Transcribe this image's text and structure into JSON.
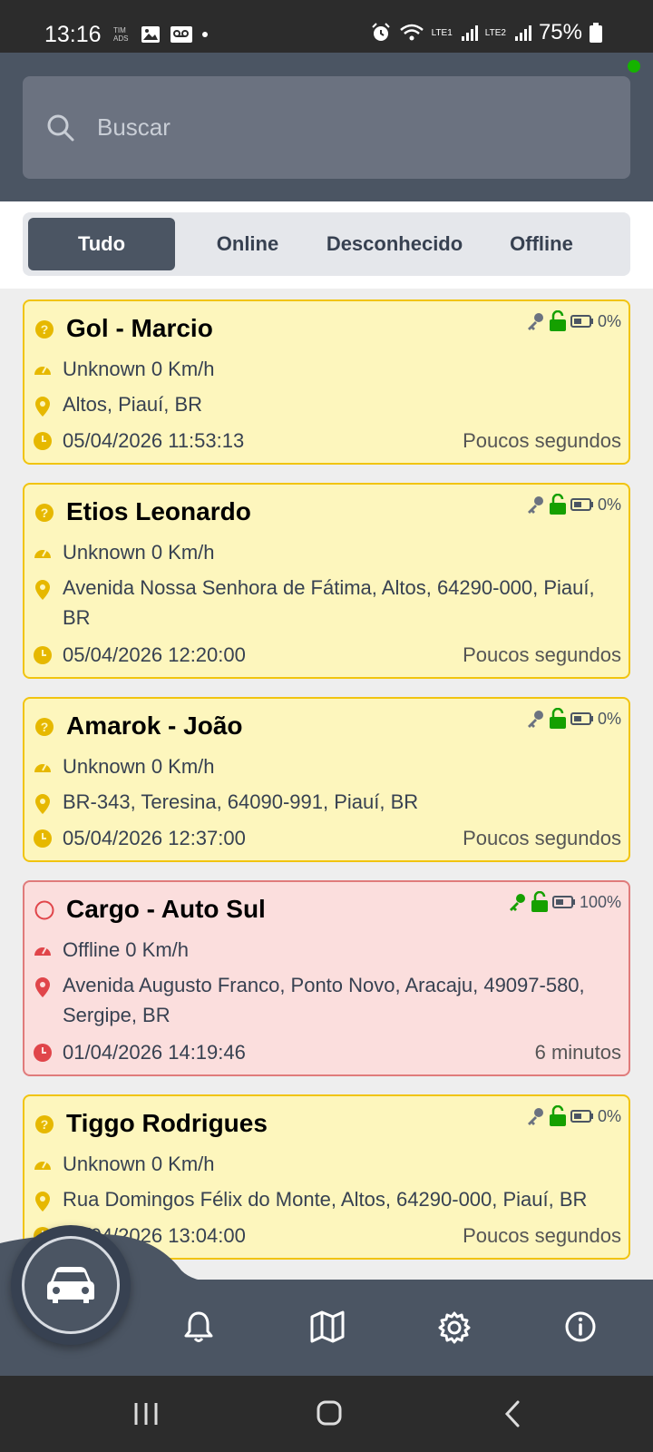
{
  "status_bar": {
    "time": "13:16",
    "battery": "75%",
    "carrier_tag": "TIM ADS",
    "lte1": "LTE1",
    "lte2": "LTE2"
  },
  "search": {
    "placeholder": "Buscar"
  },
  "tabs": [
    {
      "label": "Tudo",
      "active": true
    },
    {
      "label": "Online",
      "active": false
    },
    {
      "label": "Desconhecido",
      "active": false
    },
    {
      "label": "Offline",
      "active": false
    }
  ],
  "devices": [
    {
      "name": "Gol - Marcio",
      "status": "unknown",
      "speed": "Unknown 0 Km/h",
      "address": "Altos, Piauí, BR",
      "datetime": "05/04/2026 11:53:13",
      "ago": "Poucos segundos",
      "battery": "0%"
    },
    {
      "name": "Etios Leonardo",
      "status": "unknown",
      "speed": "Unknown 0 Km/h",
      "address": "Avenida Nossa Senhora de Fátima, Altos, 64290-000, Piauí, BR",
      "datetime": "05/04/2026 12:20:00",
      "ago": "Poucos segundos",
      "battery": "0%"
    },
    {
      "name": "Amarok - João",
      "status": "unknown",
      "speed": "Unknown 0 Km/h",
      "address": "BR-343, Teresina, 64090-991, Piauí, BR",
      "datetime": "05/04/2026 12:37:00",
      "ago": "Poucos segundos",
      "battery": "0%"
    },
    {
      "name": "Cargo - Auto Sul",
      "status": "offline",
      "speed": "Offline 0 Km/h",
      "address": "Avenida Augusto Franco, Ponto Novo, Aracaju, 49097-580, Sergipe, BR",
      "datetime": "01/04/2026 14:19:46",
      "ago": "6 minutos",
      "battery": "100%"
    },
    {
      "name": "Tiggo Rodrigues",
      "status": "unknown",
      "speed": "Unknown 0 Km/h",
      "address": "Rua Domingos Félix do Monte, Altos, 64290-000, Piauí, BR",
      "datetime": "05/04/2026 13:04:00",
      "ago": "Poucos segundos",
      "battery": "0%"
    }
  ],
  "colors": {
    "header": "#4b5563",
    "unknown_accent": "#e6b800",
    "offline_accent": "#e0454a",
    "online_green": "#15a000"
  },
  "bottom_nav": [
    "car-icon",
    "bell-icon",
    "map-icon",
    "gear-icon",
    "info-icon"
  ]
}
